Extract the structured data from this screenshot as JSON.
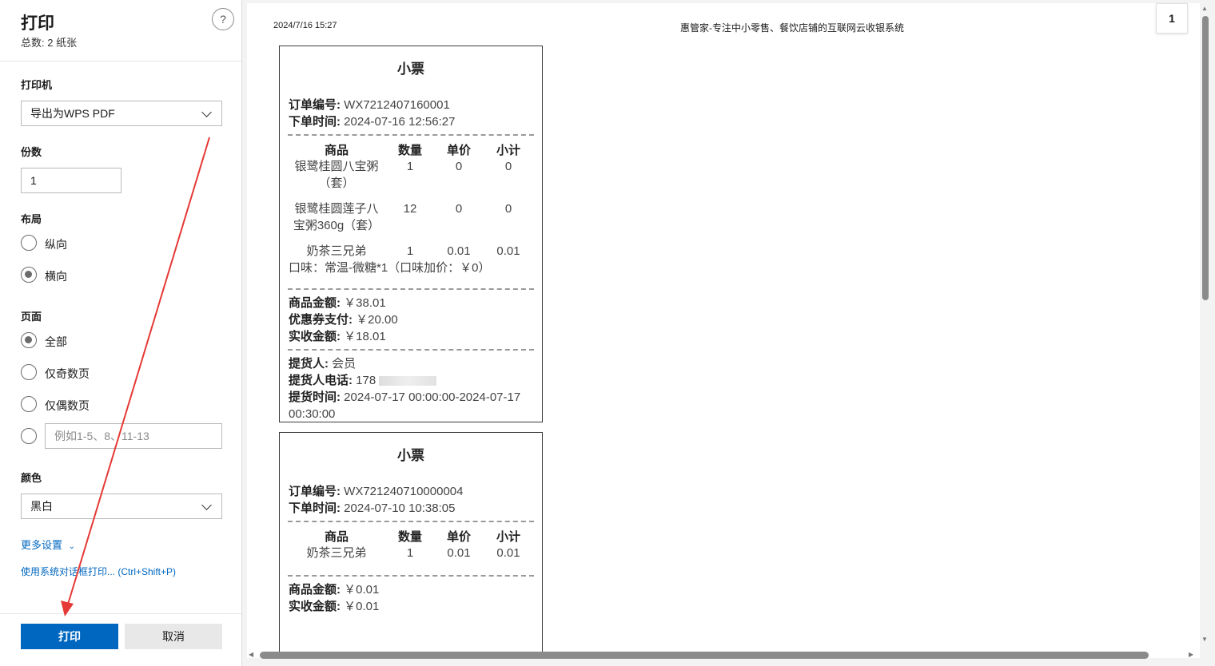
{
  "dialog": {
    "title": "打印",
    "total": "总数: 2 纸张",
    "help": "?"
  },
  "printer": {
    "label": "打印机",
    "value": "导出为WPS PDF"
  },
  "copies": {
    "label": "份数",
    "value": "1"
  },
  "layout": {
    "label": "布局",
    "options": [
      "纵向",
      "横向"
    ],
    "selected": "横向"
  },
  "pages": {
    "label": "页面",
    "options": [
      "全部",
      "仅奇数页",
      "仅偶数页"
    ],
    "selected": "全部",
    "custom_placeholder": "例如1-5、8、11-13"
  },
  "color": {
    "label": "颜色",
    "value": "黑白"
  },
  "links": {
    "more_settings": "更多设置",
    "system_dialog": "使用系统对话框打印... (Ctrl+Shift+P)"
  },
  "buttons": {
    "print": "打印",
    "cancel": "取消"
  },
  "preview": {
    "date": "2024/7/16 15:27",
    "site_title": "惠管家-专注中小零售、餐饮店铺的互联网云收银系统",
    "page_number": "1",
    "receipts": [
      {
        "title": "小票",
        "order_label": "订单编号:",
        "order_no": "WX7212407160001",
        "time_label": "下单时间:",
        "time": "2024-07-16 12:56:27",
        "headers": [
          "商品",
          "数量",
          "单价",
          "小计"
        ],
        "items": [
          {
            "name": "银鹭桂圆八宝粥（套）",
            "qty": "1",
            "price": "0",
            "subtotal": "0"
          },
          {
            "name": "银鹭桂圆莲子八宝粥360g（套）",
            "qty": "12",
            "price": "0",
            "subtotal": "0"
          },
          {
            "name": "奶茶三兄弟",
            "qty": "1",
            "price": "0.01",
            "subtotal": "0.01"
          }
        ],
        "item_note": "口味：常温-微糖*1（口味加价：￥0）",
        "amount_label": "商品金额:",
        "amount": "￥38.01",
        "coupon_label": "优惠券支付:",
        "coupon": "￥20.00",
        "paid_label": "实收金额:",
        "paid": "￥18.01",
        "pickup_label": "提货人:",
        "pickup": "会员",
        "phone_label": "提货人电话:",
        "phone": "178",
        "pickup_time_label": "提货时间:",
        "pickup_time": "2024-07-17 00:00:00-2024-07-17",
        "pickup_time_end": "00:30:00"
      },
      {
        "title": "小票",
        "order_label": "订单编号:",
        "order_no": "WX721240710000004",
        "time_label": "下单时间:",
        "time": "2024-07-10 10:38:05",
        "headers": [
          "商品",
          "数量",
          "单价",
          "小计"
        ],
        "items": [
          {
            "name": "奶茶三兄弟",
            "qty": "1",
            "price": "0.01",
            "subtotal": "0.01"
          }
        ],
        "amount_label": "商品金额:",
        "amount": "￥0.01",
        "paid_label": "实收金额:",
        "paid": "￥0.01"
      }
    ]
  },
  "accent_color": "#0067c0",
  "annotation_color": "#e53935"
}
